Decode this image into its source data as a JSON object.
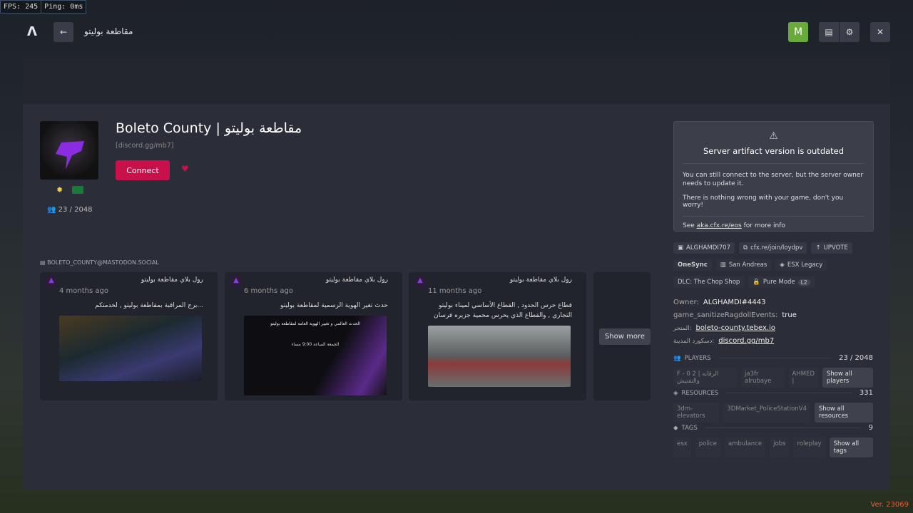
{
  "debug": {
    "fps": "FPS: 245",
    "ping": "Ping: 0ms"
  },
  "header": {
    "logo": "Λ",
    "back": "←",
    "title": "مقاطعة بوليتو",
    "user_initial": "M",
    "close": "✕"
  },
  "server": {
    "name": "Boleto County | مقاطعة بوليتو",
    "subtitle": "[discord.gg/mb7]",
    "connect": "Connect",
    "players": "23 / 2048",
    "flag": "SA"
  },
  "mastodon": {
    "handle": "BOLETO_COUNTY@MASTODON.SOCIAL"
  },
  "posts": [
    {
      "author": "رول بلاي مقاطعة بوليتو",
      "time": "4 months ago",
      "text": "...برج المراقبة بمقاطعة بوليتو , لخدمتكم"
    },
    {
      "author": "رول بلاي مقاطعة بوليتو",
      "time": "6 months ago",
      "text": "حدث تغير الهوية الرسمية لمقاطعة بوليتو",
      "image_title": "الحدث العالمي و تغيير الهوية العامة لمقاطعة بوليتو",
      "image_sub": "الجمعة الساعة 9:00 مساء"
    },
    {
      "author": "رول بلاي مقاطعة بوليتو",
      "time": "11 months ago",
      "text": "قطاع حرس الحدود , القطاع الأساسي لميناء بوليتو التجاري , والقطاع الذي يحرس محمية جزيره فرسان"
    }
  ],
  "show_more": "Show more",
  "warning": {
    "title": "Server artifact version is outdated",
    "p1": "You can still connect to the server, but the server owner needs to update it.",
    "p2": "There is nothing wrong with your game, don't you worry!",
    "p3_pre": "See ",
    "p3_link": "aka.cfx.re/eos",
    "p3_post": " for more info"
  },
  "chips": {
    "owner_tag": "ALGHAMDI707",
    "join": "cfx.re/join/loydpv",
    "upvote": "UPVOTE",
    "onesync": "OneSync",
    "map": "San Andreas",
    "framework": "ESX Legacy",
    "dlc": "DLC: The Chop Shop",
    "pure": "Pure Mode",
    "pure_level": "L2"
  },
  "vars": [
    {
      "key": "Owner:",
      "value": "ALGHAMDI#4443",
      "link": false
    },
    {
      "key": "game_sanitizeRagdollEvents:",
      "value": "true",
      "link": false
    },
    {
      "key": "المتجر:",
      "value": "boleto-county.tebex.io",
      "link": true
    },
    {
      "key": "دسكورد المدينة:",
      "value": "discord.gg/mb7",
      "link": true
    }
  ],
  "players": {
    "label": "PLAYERS",
    "count": "23 / 2048",
    "items": [
      "F - 0 2 | الرقابه والتفتيش",
      "ja3fr alrubaye",
      "AHMED |"
    ],
    "show_all": "Show all players"
  },
  "resources": {
    "label": "RESOURCES",
    "count": "331",
    "items": [
      "3dm-elevators",
      "3DMarket_PoliceStationV4"
    ],
    "show_all": "Show all resources"
  },
  "tags": {
    "label": "TAGS",
    "count": "9",
    "items": [
      "esx",
      "police",
      "ambulance",
      "jobs",
      "roleplay"
    ],
    "show_all": "Show all tags"
  },
  "version": "Ver. 23069",
  "colors": {
    "accent": "#c8104a",
    "user": "#6aaa3a"
  }
}
